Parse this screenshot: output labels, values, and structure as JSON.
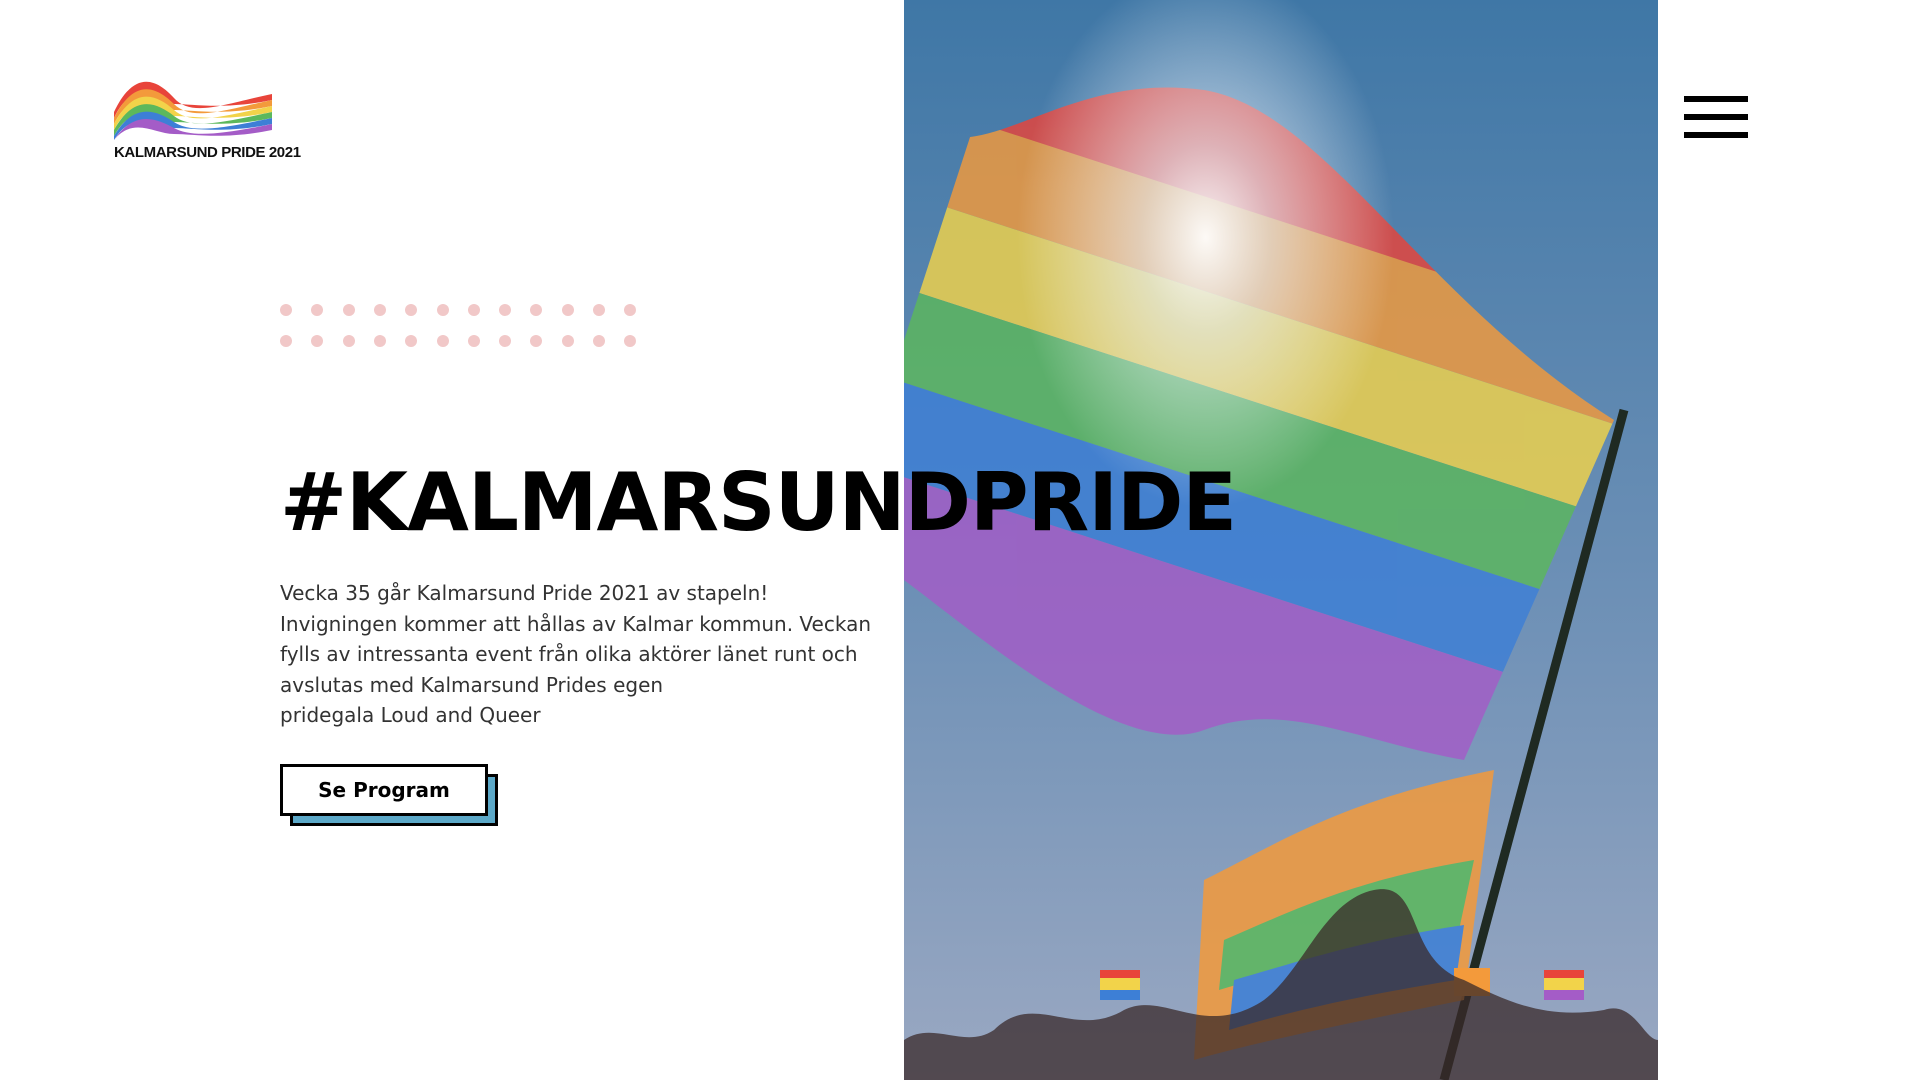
{
  "logo": {
    "text": "KALMARSUND PRIDE 2021",
    "icon": "rainbow-wave-icon"
  },
  "hero": {
    "title": "#KALMARSUNDPRIDE",
    "intro_lines": [
      "Vecka 35 går Kalmarsund Pride 2021 av stapeln!",
      "Invigningen kommer att hållas av Kalmar kommun. Veckan",
      "fylls av intressanta event från olika aktörer länet runt och",
      "avslutas med Kalmarsund Prides egen",
      "pridegala Loud and Queer"
    ],
    "cta_label": "Se Program"
  },
  "menu": {
    "icon": "hamburger-menu-icon"
  },
  "image": {
    "subject": "rainbow pride flags against blue sky"
  },
  "colors": {
    "dot": "#f1c8c8",
    "button_shadow": "#5ba8c8",
    "sky_top": "#3f77a6",
    "sky_bottom": "#9aa8c2",
    "rainbow": [
      "#e8443a",
      "#f39a3b",
      "#f2d34a",
      "#5cb85c",
      "#3d7fd6",
      "#a45cc7"
    ]
  }
}
